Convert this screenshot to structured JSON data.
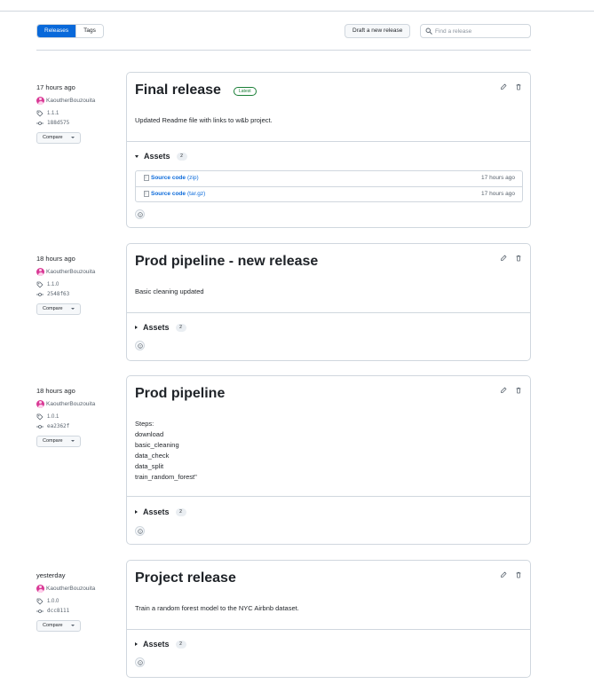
{
  "subnav": {
    "tabs": [
      {
        "label": "Releases",
        "active": true
      },
      {
        "label": "Tags",
        "active": false
      }
    ],
    "draft_label": "Draft a new release",
    "search_placeholder": "Find a release"
  },
  "compare_label": "Compare",
  "assets_label": "Assets",
  "releases": [
    {
      "date": "17 hours ago",
      "author": "KaoutherBouzouita",
      "tag": "1.1.1",
      "commit": "188d575",
      "title": "Final release",
      "latest_badge": "Latest",
      "notes": [
        "Updated Readme file with links to w&b project."
      ],
      "asset_count": "2",
      "assets_expanded": true,
      "assets": [
        {
          "name": "Source code",
          "ext": "(zip)",
          "time": "17 hours ago"
        },
        {
          "name": "Source code",
          "ext": "(tar.gz)",
          "time": "17 hours ago"
        }
      ]
    },
    {
      "date": "18 hours ago",
      "author": "KaoutherBouzouita",
      "tag": "1.1.0",
      "commit": "2548f63",
      "title": "Prod pipeline - new release",
      "notes": [
        "Basic cleaning updated"
      ],
      "asset_count": "2",
      "assets_expanded": false
    },
    {
      "date": "18 hours ago",
      "author": "KaoutherBouzouita",
      "tag": "1.0.1",
      "commit": "ea2362f",
      "title": "Prod pipeline",
      "notes": [
        "Steps:",
        "download",
        "basic_cleaning",
        "data_check",
        "data_split",
        "train_random_forest\""
      ],
      "asset_count": "2",
      "assets_expanded": false
    },
    {
      "date": "yesterday",
      "author": "KaoutherBouzouita",
      "tag": "1.0.0",
      "commit": "dcc8111",
      "title": "Project release",
      "notes": [
        "Train a random forest model to the NYC Airbnb dataset."
      ],
      "asset_count": "2",
      "assets_expanded": false
    }
  ],
  "colors": {
    "accent": "#0969da",
    "border": "#d0d7de",
    "latest": "#1a7f37",
    "muted": "#59636e"
  }
}
